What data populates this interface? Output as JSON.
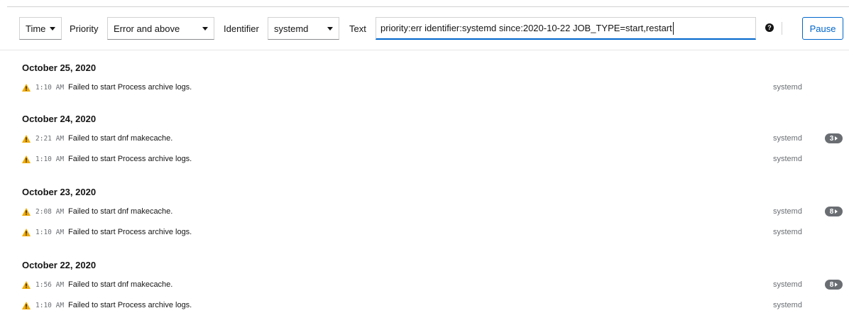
{
  "toolbar": {
    "time_label": "Time",
    "priority_label": "Priority",
    "priority_value": "Error and above",
    "identifier_label": "Identifier",
    "identifier_value": "systemd",
    "text_label": "Text",
    "text_value": "priority:err identifier:systemd since:2020-10-22 JOB_TYPE=start,restart",
    "help_glyph": "?",
    "pause_label": "Pause"
  },
  "colors": {
    "accent": "#0066cc",
    "warning": "#f0ab00",
    "badge": "#6a6e73"
  },
  "days": [
    {
      "date": "October 25, 2020",
      "entries": [
        {
          "icon": "warning-icon",
          "time": "1:10 AM",
          "message": "Failed to start Process archive logs.",
          "identifier": "systemd",
          "count": ""
        }
      ]
    },
    {
      "date": "October 24, 2020",
      "entries": [
        {
          "icon": "warning-icon",
          "time": "2:21 AM",
          "message": "Failed to start dnf makecache.",
          "identifier": "systemd",
          "count": "3"
        },
        {
          "icon": "warning-icon",
          "time": "1:10 AM",
          "message": "Failed to start Process archive logs.",
          "identifier": "systemd",
          "count": ""
        }
      ]
    },
    {
      "date": "October 23, 2020",
      "entries": [
        {
          "icon": "warning-icon",
          "time": "2:08 AM",
          "message": "Failed to start dnf makecache.",
          "identifier": "systemd",
          "count": "8"
        },
        {
          "icon": "warning-icon",
          "time": "1:10 AM",
          "message": "Failed to start Process archive logs.",
          "identifier": "systemd",
          "count": ""
        }
      ]
    },
    {
      "date": "October 22, 2020",
      "entries": [
        {
          "icon": "warning-icon",
          "time": "1:56 AM",
          "message": "Failed to start dnf makecache.",
          "identifier": "systemd",
          "count": "8"
        },
        {
          "icon": "warning-icon",
          "time": "1:10 AM",
          "message": "Failed to start Process archive logs.",
          "identifier": "systemd",
          "count": ""
        }
      ]
    }
  ]
}
